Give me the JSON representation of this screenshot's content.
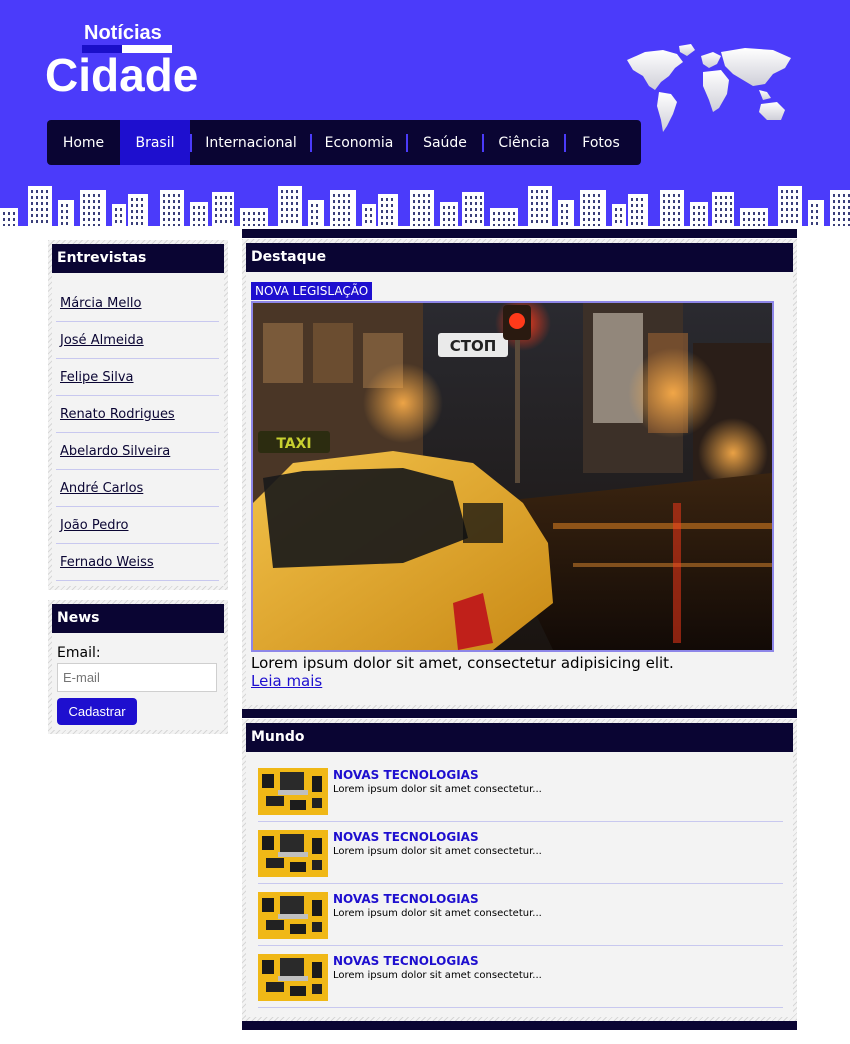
{
  "logo": {
    "top": "Notícias",
    "main": "Cidade"
  },
  "nav": {
    "items": [
      {
        "label": "Home"
      },
      {
        "label": "Brasil"
      },
      {
        "label": "Internacional"
      },
      {
        "label": "Economia"
      },
      {
        "label": "Saúde"
      },
      {
        "label": "Ciência"
      },
      {
        "label": "Fotos"
      }
    ],
    "active": "Brasil"
  },
  "sidebar": {
    "interviews": {
      "title": "Entrevistas",
      "items": [
        "Márcia Mello",
        "José Almeida",
        "Felipe Silva",
        "Renato Rodrigues",
        "Abelardo Silveira",
        "André Carlos",
        "João Pedro",
        "Fernado Weiss"
      ]
    },
    "news": {
      "title": "News",
      "email_label": "Email:",
      "email_placeholder": "E-mail",
      "button_label": "Cadastrar"
    }
  },
  "featured": {
    "title": "Destaque",
    "tag": "NOVA LEGISLAÇÃO",
    "image_sign_text": "СТОП",
    "image_taxi_text": "TAXI",
    "text": "Lorem ipsum dolor sit amet, consectetur adipisicing elit.",
    "link": "Leia mais"
  },
  "world": {
    "title": "Mundo",
    "items": [
      {
        "title": "NOVAS TECNOLOGIAS",
        "summary": "Lorem ipsum dolor sit amet consectetur..."
      },
      {
        "title": "NOVAS TECNOLOGIAS",
        "summary": "Lorem ipsum dolor sit amet consectetur..."
      },
      {
        "title": "NOVAS TECNOLOGIAS",
        "summary": "Lorem ipsum dolor sit amet consectetur..."
      },
      {
        "title": "NOVAS TECNOLOGIAS",
        "summary": "Lorem ipsum dolor sit amet consectetur..."
      }
    ]
  },
  "colors": {
    "header_bg": "#4b3bfa",
    "dark_navy": "#0a0533",
    "accent_blue": "#1e0fcf"
  }
}
